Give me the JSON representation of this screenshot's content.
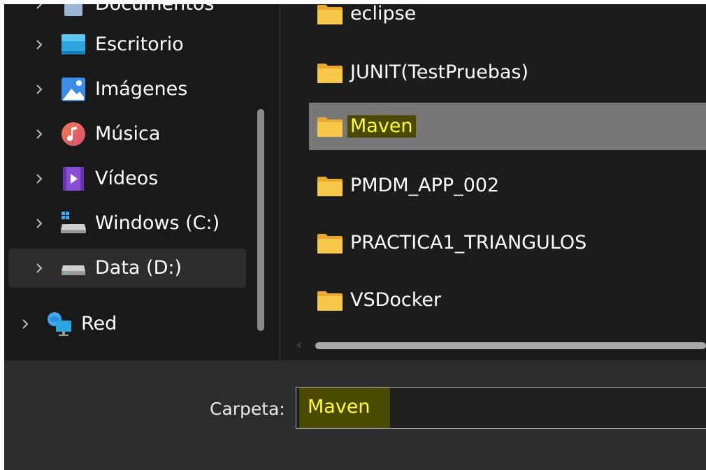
{
  "nav": {
    "items": [
      {
        "label": "Documentos",
        "icon": "documents-icon"
      },
      {
        "label": "Escritorio",
        "icon": "desktop-icon"
      },
      {
        "label": "Imágenes",
        "icon": "pictures-icon"
      },
      {
        "label": "Música",
        "icon": "music-icon"
      },
      {
        "label": "Vídeos",
        "icon": "videos-icon"
      },
      {
        "label": "Windows (C:)",
        "icon": "windows-drive-icon"
      },
      {
        "label": "Data (D:)",
        "icon": "drive-icon",
        "selected": true
      },
      {
        "label": "Red",
        "icon": "network-icon"
      }
    ]
  },
  "files": {
    "items": [
      {
        "label": "eclipse",
        "icon": "folder-icon"
      },
      {
        "label": "JUNIT(TestPruebas)",
        "icon": "folder-icon"
      },
      {
        "label": "Maven",
        "icon": "folder-icon",
        "selected": true,
        "highlighted": true
      },
      {
        "label": "PMDM_APP_002",
        "icon": "folder-icon"
      },
      {
        "label": "PRACTICA1_TRIANGULOS",
        "icon": "folder-icon"
      },
      {
        "label": "VSDocker",
        "icon": "folder-icon"
      }
    ]
  },
  "bottom": {
    "folder_label": "Carpeta:",
    "folder_value": "Maven"
  },
  "colors": {
    "highlight_text": "#ffff33",
    "highlight_bg": "#4a4a00",
    "folder_yellow": "#f8c84a",
    "selection_bg": "#777777"
  }
}
